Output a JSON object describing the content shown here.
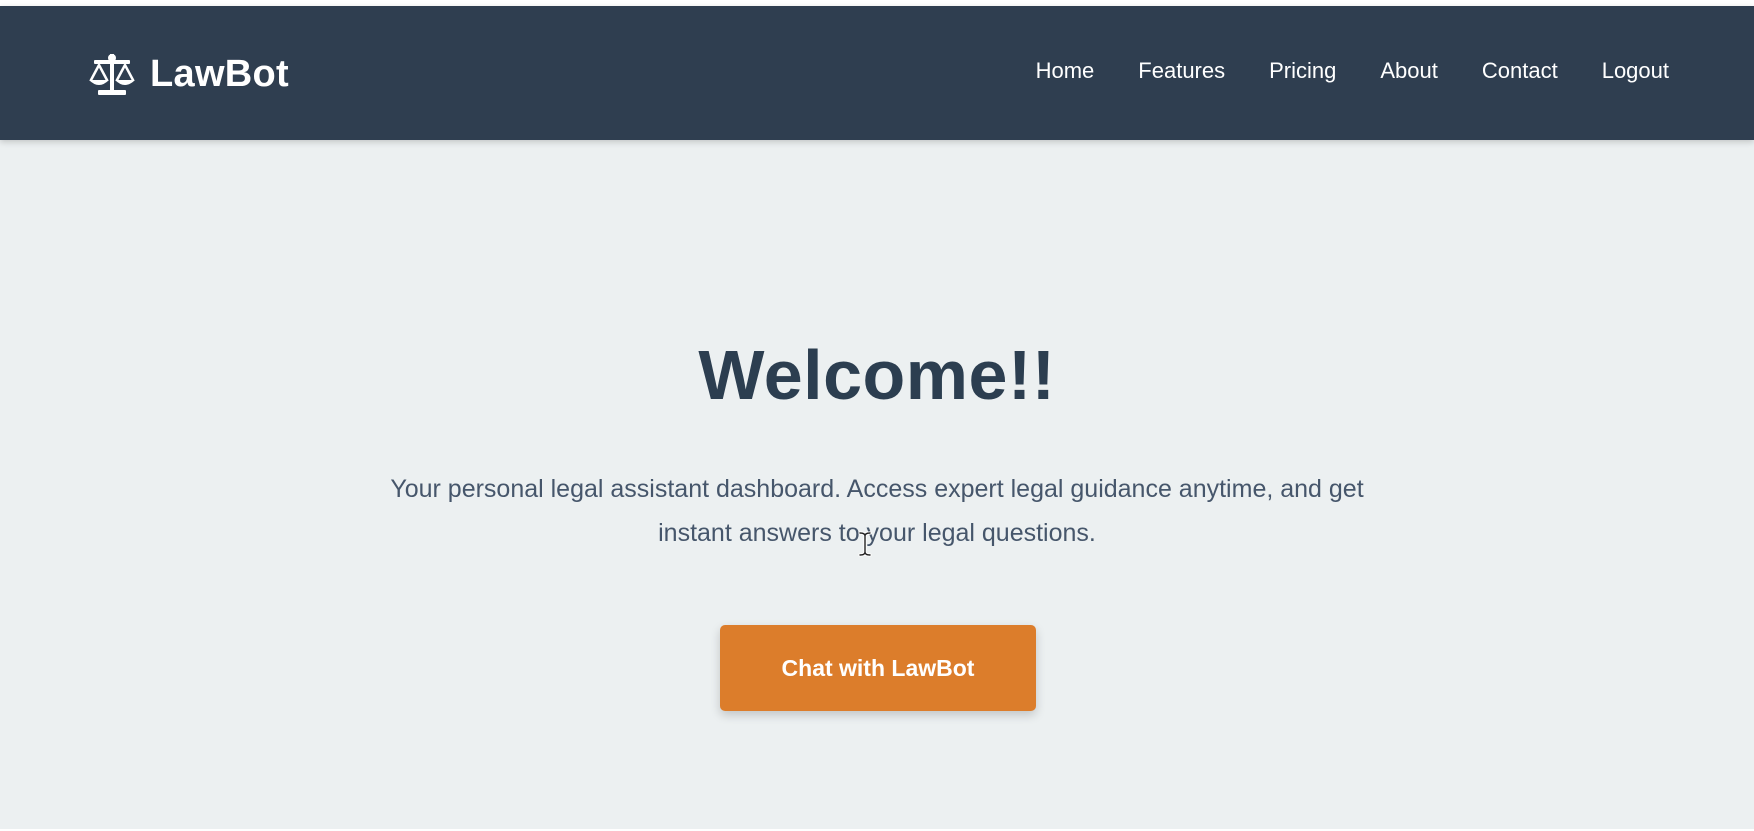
{
  "brand": {
    "name": "LawBot",
    "icon": "scales-of-justice-icon"
  },
  "nav": {
    "items": [
      {
        "label": "Home"
      },
      {
        "label": "Features"
      },
      {
        "label": "Pricing"
      },
      {
        "label": "About"
      },
      {
        "label": "Contact"
      },
      {
        "label": "Logout"
      }
    ]
  },
  "hero": {
    "title": "Welcome!!",
    "description": "Your personal legal assistant dashboard. Access expert legal guidance anytime, and get instant answers to your legal questions.",
    "cta_label": "Chat with LawBot"
  },
  "colors": {
    "navbar": "#2f3e50",
    "page_background": "#ecf0f1",
    "title": "#2c3e50",
    "body_text": "#46566b",
    "accent": "#dc7d2b",
    "nav_text": "#ffffff"
  }
}
